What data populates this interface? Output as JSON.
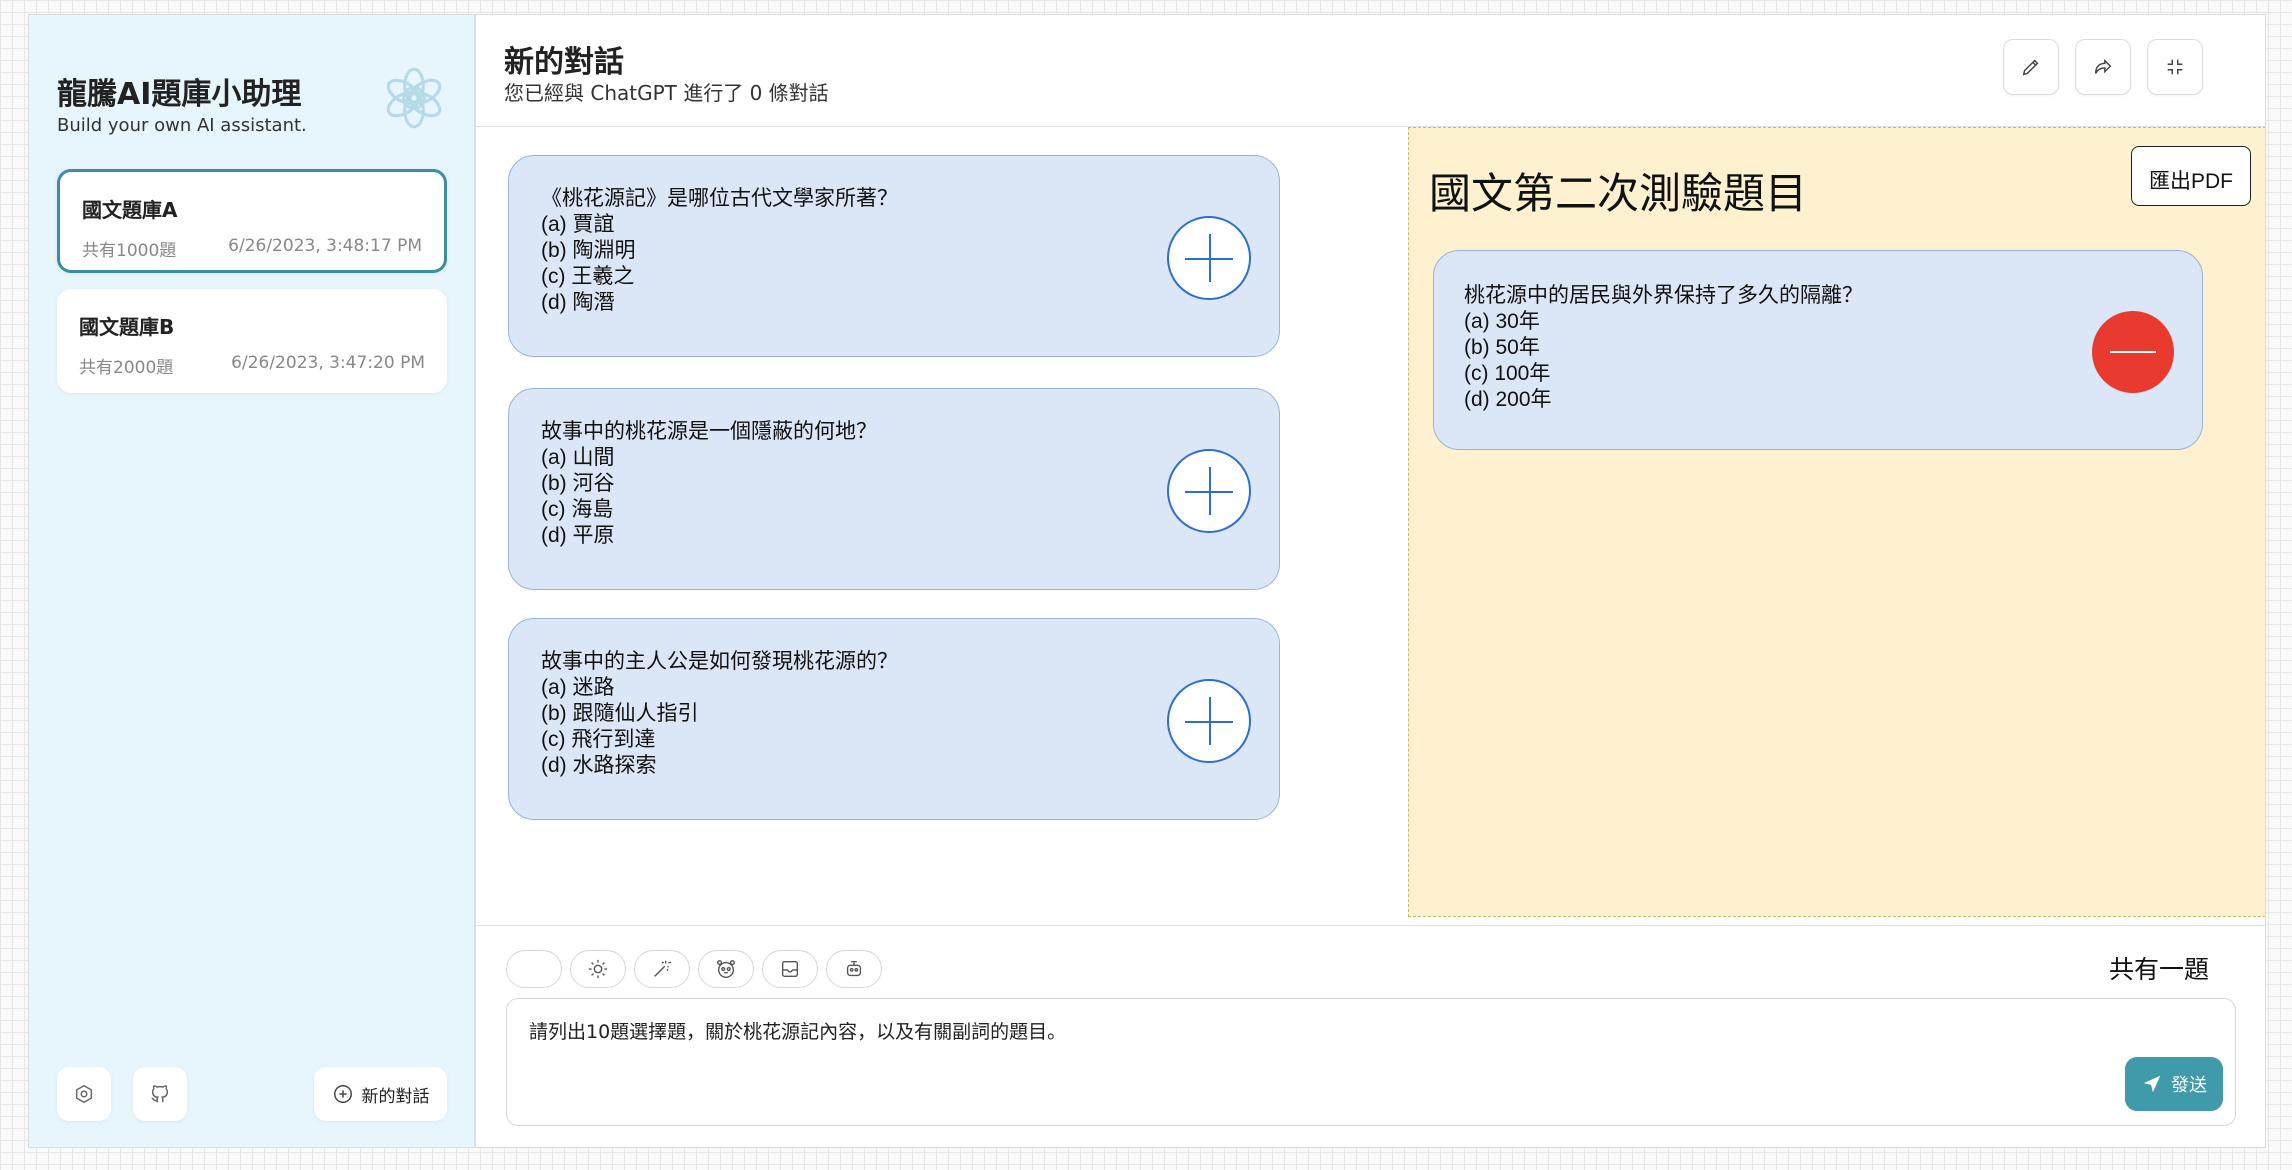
{
  "sidebar": {
    "title": "龍騰AI題庫小助理",
    "subtitle": "Build your own AI assistant.",
    "logo_icon": "openai-logo-icon",
    "sessions": [
      {
        "title": "國文題庫A",
        "count": "共有1000題",
        "date": "6/26/2023, 3:48:17 PM",
        "active": true
      },
      {
        "title": "國文題庫B",
        "count": "共有2000題",
        "date": "6/26/2023, 3:47:20 PM",
        "active": false
      }
    ],
    "footer": {
      "settings_icon": "settings-icon",
      "github_icon": "github-icon",
      "new_chat_label": "新的對話"
    }
  },
  "header": {
    "title": "新的對話",
    "subtitle": "您已經與 ChatGPT 進行了 0 條對話",
    "buttons": [
      "edit-icon",
      "share-icon",
      "collapse-icon"
    ]
  },
  "questions": [
    {
      "text": "《桃花源記》是哪位古代文學家所著？\n(a) 賈誼\n(b) 陶淵明\n(c) 王羲之\n(d) 陶潛"
    },
    {
      "text": "故事中的桃花源是一個隱蔽的何地？\n(a) 山間\n(b) 河谷\n(c) 海島\n(d) 平原"
    },
    {
      "text": "故事中的主人公是如何發現桃花源的？\n(a) 迷路\n(b) 跟隨仙人指引\n(c) 飛行到達\n(d) 水路探索"
    }
  ],
  "exam": {
    "title": "國文第二次測驗題目",
    "export_label": "匯出PDF",
    "selected": [
      {
        "text": "桃花源中的居民與外界保持了多久的隔離？\n(a) 30年\n(b) 50年\n(c) 100年\n(d) 200年"
      }
    ]
  },
  "input": {
    "tools": [
      "blank-tool",
      "sun-icon",
      "magic-wand-icon",
      "face-icon",
      "image-icon",
      "robot-icon"
    ],
    "count_label": "共有一題",
    "prompt": "請列出10題選擇題，關於桃花源記內容，以及有關副詞的題目。",
    "send_label": "發送"
  },
  "colors": {
    "sidebar_bg": "#e7f5fd",
    "accent": "#3b8ea0",
    "card_bg": "#dbe6f7",
    "plus": "#2d6fd0",
    "minus": "#e83a2e",
    "exam_bg": "#fdf1cf",
    "send": "#3f9aa9"
  }
}
